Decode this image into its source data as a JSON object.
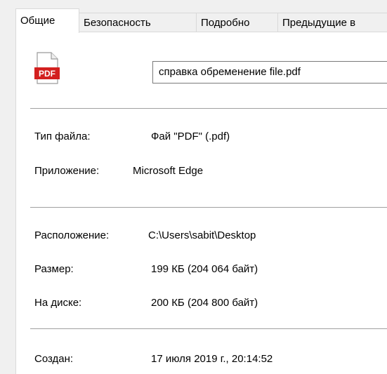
{
  "tabs": [
    {
      "label": "Общие",
      "active": true
    },
    {
      "label": "Безопасность",
      "active": false
    },
    {
      "label": "Подробно",
      "active": false
    },
    {
      "label": "Предыдущие в",
      "active": false
    }
  ],
  "file": {
    "icon_text": "PDF",
    "name": "справка обременение file.pdf"
  },
  "properties": {
    "type_label": "Тип файла:",
    "type_value": "Фай  \"PDF\" (.pdf)",
    "app_label": "Приложение:",
    "app_value": "Microsoft Edge",
    "location_label": "Расположение:",
    "location_value": "C:\\Users\\sabit\\Desktop",
    "size_label": "Размер:",
    "size_value": "199 КБ (204 064 байт)",
    "disk_label": "На диске:",
    "disk_value": "200 КБ (204 800 байт)",
    "created_label": "Создан:",
    "created_value": "17 июля 2019 г., 20:14:52"
  },
  "colors": {
    "pdf_red": "#d3201f",
    "panel_bg": "#ffffff",
    "window_bg": "#f0f0f0"
  }
}
